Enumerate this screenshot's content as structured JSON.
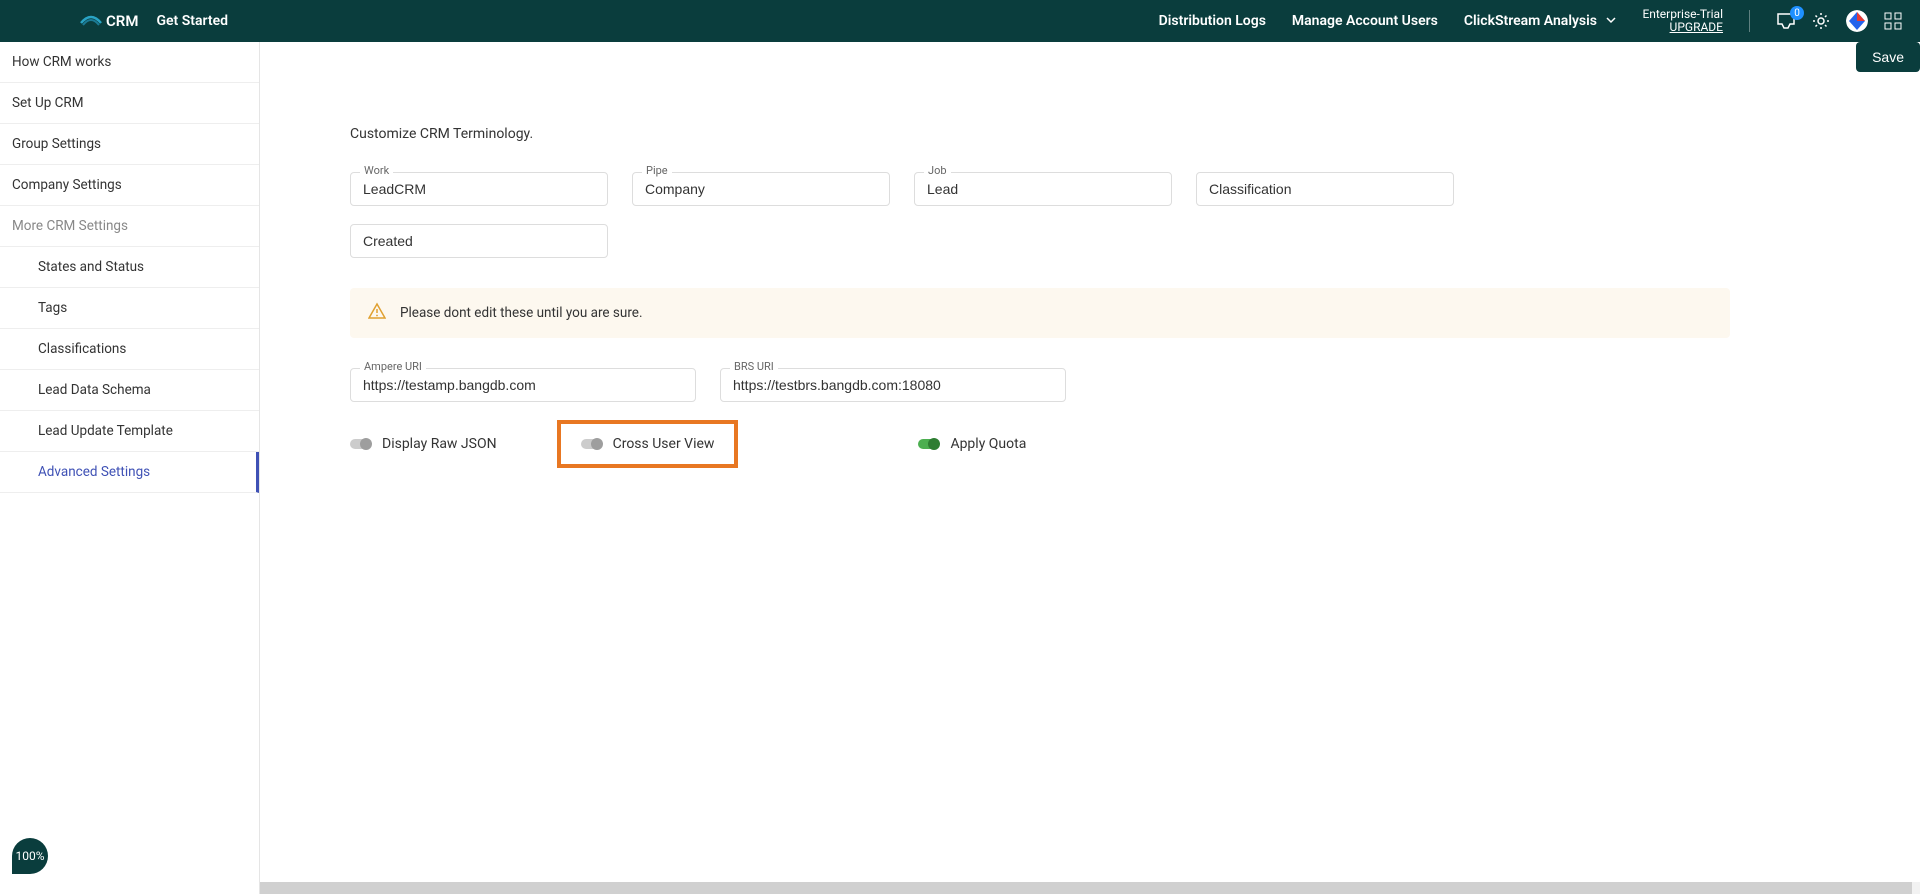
{
  "header": {
    "app_name": "CRM",
    "get_started": "Get Started",
    "nav": {
      "distribution_logs": "Distribution Logs",
      "manage_users": "Manage Account Users",
      "clickstream": "ClickStream Analysis"
    },
    "plan": {
      "name": "Enterprise-Trial",
      "upgrade": "UPGRADE"
    },
    "inbox_badge": "0"
  },
  "sidebar": {
    "how_works": "How CRM works",
    "setup": "Set Up CRM",
    "group_settings": "Group Settings",
    "company_settings": "Company Settings",
    "more_settings": "More CRM Settings",
    "states_status": "States and Status",
    "tags": "Tags",
    "classifications": "Classifications",
    "lead_schema": "Lead Data Schema",
    "lead_template": "Lead Update Template",
    "advanced": "Advanced Settings"
  },
  "main": {
    "save_label": "Save",
    "title": "Customize CRM Terminology.",
    "fields": {
      "work": {
        "label": "Work",
        "value": "LeadCRM"
      },
      "pipe": {
        "label": "Pipe",
        "value": "Company"
      },
      "job": {
        "label": "Job",
        "value": "Lead"
      },
      "classification": {
        "placeholder": "Classification",
        "value": ""
      },
      "created": {
        "value": "Created"
      }
    },
    "warning": "Please dont edit these until you are sure.",
    "uri_fields": {
      "ampere": {
        "label": "Ampere URI",
        "value": "https://testamp.bangdb.com"
      },
      "brs": {
        "label": "BRS URI",
        "value": "https://testbrs.bangdb.com:18080"
      }
    },
    "toggles": {
      "raw_json": {
        "label": "Display Raw JSON",
        "on": false
      },
      "cross_user": {
        "label": "Cross User View",
        "on": false
      },
      "apply_quota": {
        "label": "Apply Quota",
        "on": true
      }
    }
  },
  "progress": "100%"
}
